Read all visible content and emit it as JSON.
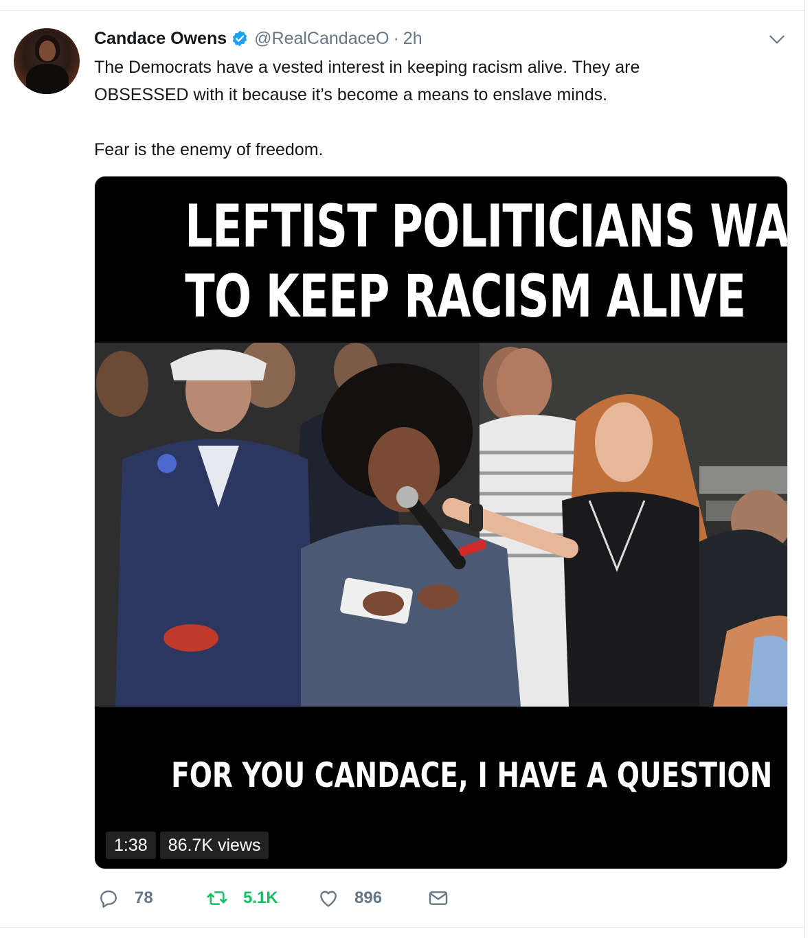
{
  "author": {
    "name": "Candace Owens",
    "handle": "@RealCandaceO",
    "separator": "·",
    "time": "2h",
    "verified": true
  },
  "tweet": {
    "lines": [
      "The Democrats have a vested interest in keeping racism alive. They are",
      "OBSESSED with it because it’s become a means to enslave minds."
    ],
    "second_paragraph": "Fear is the enemy of freedom."
  },
  "media": {
    "headline_line1": "LEFTIST POLITICIANS WANT",
    "headline_line2": "TO KEEP RACISM ALIVE",
    "subtitle": "FOR YOU CANDACE, I HAVE A QUESTION",
    "duration": "1:38",
    "views": "86.7K views"
  },
  "actions": {
    "replies": "78",
    "retweets": "5.1K",
    "likes": "896"
  },
  "icons": {
    "verified": "verified-badge-icon",
    "caret": "chevron-down-icon",
    "reply": "reply-icon",
    "retweet": "retweet-icon",
    "like": "heart-icon",
    "dm": "envelope-icon"
  },
  "colors": {
    "verified_blue": "#1da1f2",
    "retweet_green": "#17bf63",
    "muted": "#657786",
    "text": "#14171a"
  }
}
